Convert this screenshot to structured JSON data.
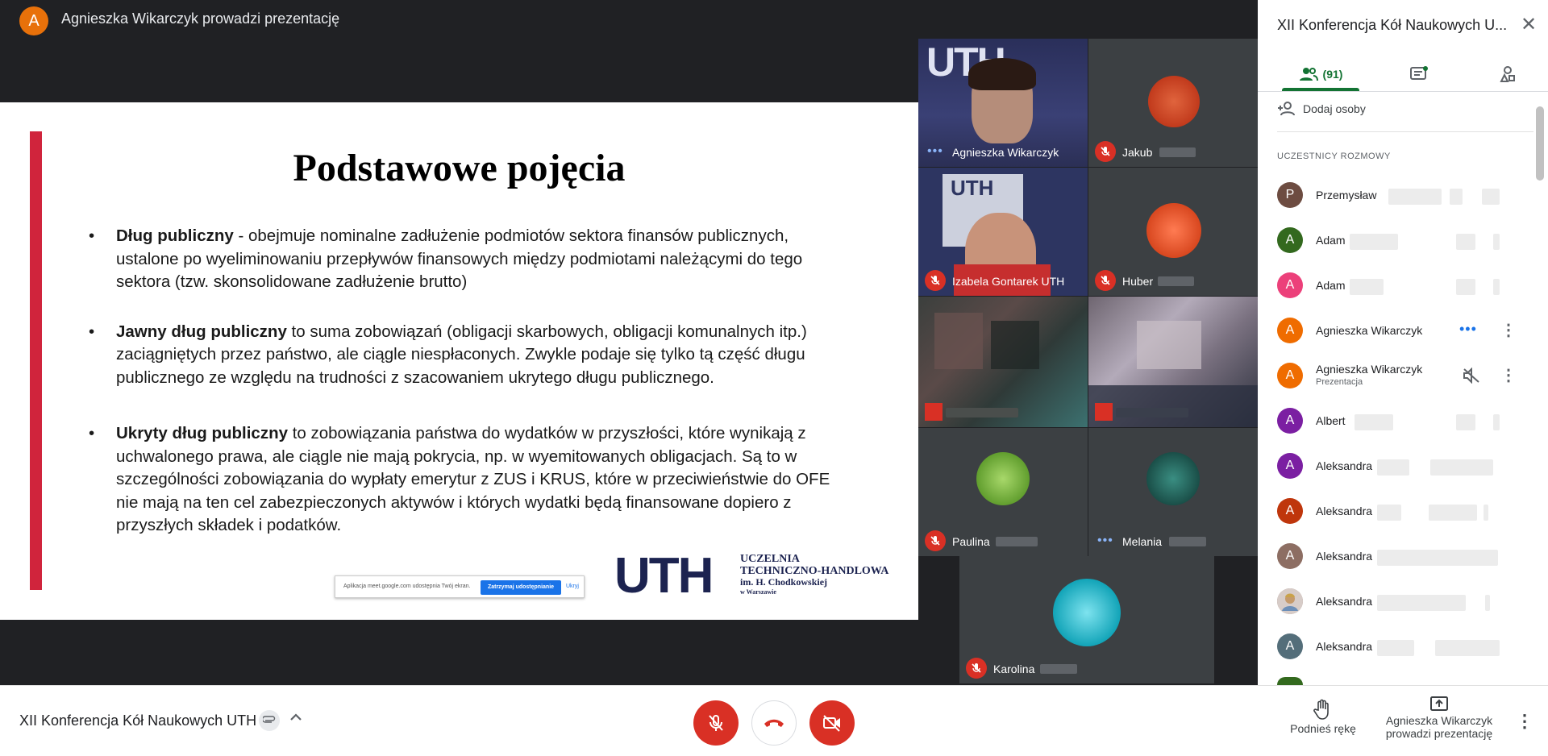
{
  "presenter_banner": {
    "avatar_letter": "A",
    "text": "Agnieszka Wikarczyk prowadzi prezentację"
  },
  "slide": {
    "title": "Podstawowe pojęcia",
    "bullets": [
      {
        "term": "Dług publiczny",
        "text": "  - obejmuje nominalne zadłużenie podmiotów sektora finansów publicznych, ustalone po wyeliminowaniu przepływów finansowych między podmiotami należącymi do tego sektora (tzw. skonsolidowane zadłużenie brutto)"
      },
      {
        "term": "Jawny dług publiczny",
        "text": " to suma zobowiązań (obligacji skarbowych, obligacji komunalnych itp.) zaciągniętych przez państwo, ale ciągle niespłaconych. Zwykle podaje się tylko tą część długu publicznego ze względu na trudności z szacowaniem ukrytego długu publicznego."
      },
      {
        "term": "Ukryty dług publiczny",
        "text": " to zobowiązania państwa do wydatków w przyszłości, które wynikają z uchwalonego prawa, ale ciągle nie mają pokrycia, np. w wyemitowanych obligacjach. Są to w szczególności zobowiązania do wypłaty emerytur z ZUS i KRUS, które w przeciwieństwie do OFE nie mają na ten cel zabezpieczonych aktywów i których wydatki będą finansowane dopiero z przyszłych składek i podatków."
      }
    ],
    "share_notice": "Aplikacja meet.google.com udostępnia Twój ekran.",
    "share_stop_label": "Zatrzymaj udostępnianie",
    "share_hide_label": "Ukryj",
    "logo": {
      "mark": "UTH",
      "line1": "UCZELNIA",
      "line2": "TECHNICZNO-HANDLOWA",
      "line3": "im. H. Chodkowskiej",
      "line4": "w Warszawie"
    }
  },
  "participants_grid": [
    {
      "name": "Agnieszka Wikarczyk",
      "status": "speaking"
    },
    {
      "name": "Jakub",
      "status": "muted"
    },
    {
      "name": "Izabela Gontarek UTH",
      "status": "muted"
    },
    {
      "name": "Huber",
      "status": "muted"
    },
    {
      "name": "",
      "status": "muted"
    },
    {
      "name": "",
      "status": "muted"
    },
    {
      "name": "Paulina",
      "status": "muted"
    },
    {
      "name": "Melania",
      "status": "speaking"
    },
    {
      "name": "Karolina",
      "status": "muted"
    }
  ],
  "sidebar": {
    "title": "XII Konferencja Kół Naukowych U...",
    "people_count": "(91)",
    "add_people_label": "Dodaj osoby",
    "section_label": "UCZESTNICY ROZMOWY",
    "people": [
      {
        "letter": "P",
        "color": "#6d4c41",
        "name": "Przemysław",
        "sub": ""
      },
      {
        "letter": "A",
        "color": "#33691e",
        "name": "Adam",
        "sub": ""
      },
      {
        "letter": "A",
        "color": "#ec407a",
        "name": "Adam",
        "sub": ""
      },
      {
        "letter": "A",
        "color": "#ef6c00",
        "name": "Agnieszka Wikarczyk",
        "sub": ""
      },
      {
        "letter": "A",
        "color": "#ef6c00",
        "name": "Agnieszka Wikarczyk",
        "sub": "Prezentacja"
      },
      {
        "letter": "A",
        "color": "#7b1fa2",
        "name": "Albert",
        "sub": ""
      },
      {
        "letter": "A",
        "color": "#7b1fa2",
        "name": "Aleksandra",
        "sub": ""
      },
      {
        "letter": "A",
        "color": "#bf360c",
        "name": "Aleksandra",
        "sub": ""
      },
      {
        "letter": "A",
        "color": "#8d6e63",
        "name": "Aleksandra",
        "sub": ""
      },
      {
        "letter": "",
        "color": "#a1887f",
        "name": "Aleksandra",
        "sub": ""
      },
      {
        "letter": "A",
        "color": "#546e7a",
        "name": "Aleksandra",
        "sub": ""
      }
    ]
  },
  "bottom": {
    "meeting_name": "XII Konferencja Kół Naukowych UTH",
    "raise_hand_label": "Podnieś rękę",
    "presenting_label_1": "Agnieszka Wikarczyk",
    "presenting_label_2": "prowadzi prezentację"
  },
  "colors": {
    "accent_red": "#d93025",
    "accent_green": "#137333",
    "brand_blue": "#1c2350"
  }
}
